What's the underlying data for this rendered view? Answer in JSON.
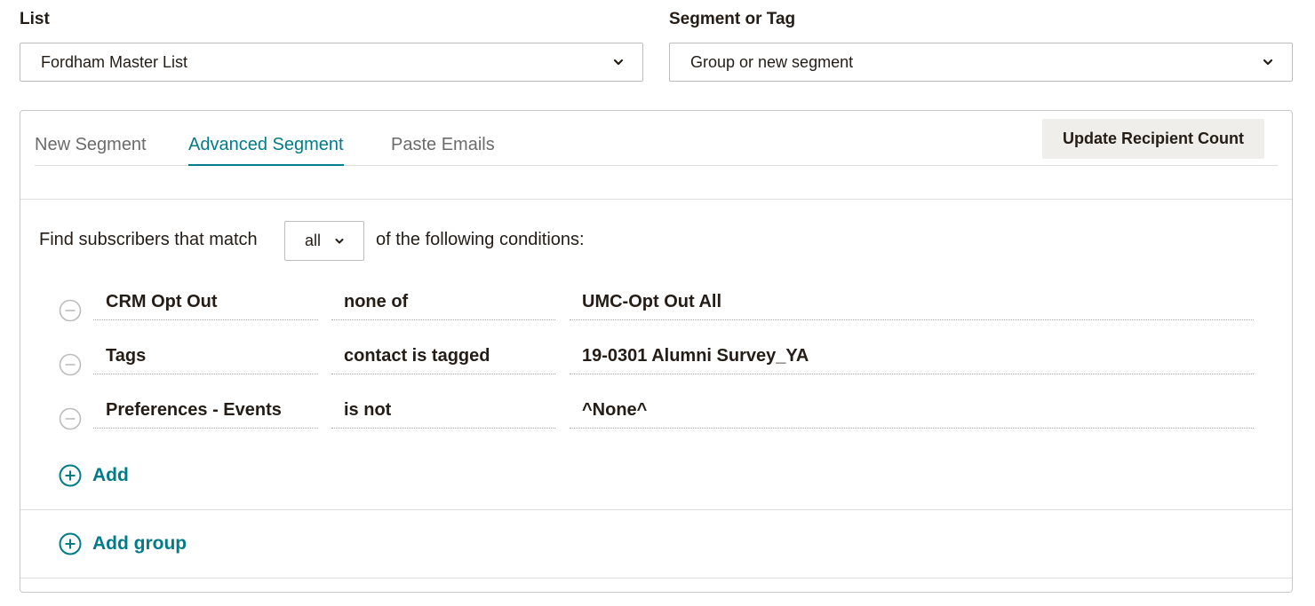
{
  "list": {
    "label": "List",
    "value": "Fordham Master List"
  },
  "segment": {
    "label": "Segment or Tag",
    "value": "Group or new segment"
  },
  "tabs": [
    {
      "label": "New Segment"
    },
    {
      "label": "Advanced Segment"
    },
    {
      "label": "Paste Emails"
    }
  ],
  "active_tab": "Advanced Segment",
  "update_button": "Update Recipient Count",
  "match": {
    "prefix": "Find subscribers that match",
    "value": "all",
    "suffix": "of the following conditions:"
  },
  "conditions": [
    {
      "field": "CRM Opt Out",
      "operator": "none of",
      "value": "UMC-Opt Out All"
    },
    {
      "field": "Tags",
      "operator": "contact is tagged",
      "value": "19-0301 Alumni Survey_YA"
    },
    {
      "field": "Preferences - Events",
      "operator": "is not",
      "value": "^None^"
    }
  ],
  "add_label": "Add",
  "add_group_label": "Add group",
  "colors": {
    "accent": "#007c89",
    "text": "#241c15",
    "button_bg": "#efeeea"
  },
  "icons": {
    "remove": "minus-circle-icon",
    "add": "plus-circle-icon",
    "dropdown": "chevron-down-icon"
  }
}
